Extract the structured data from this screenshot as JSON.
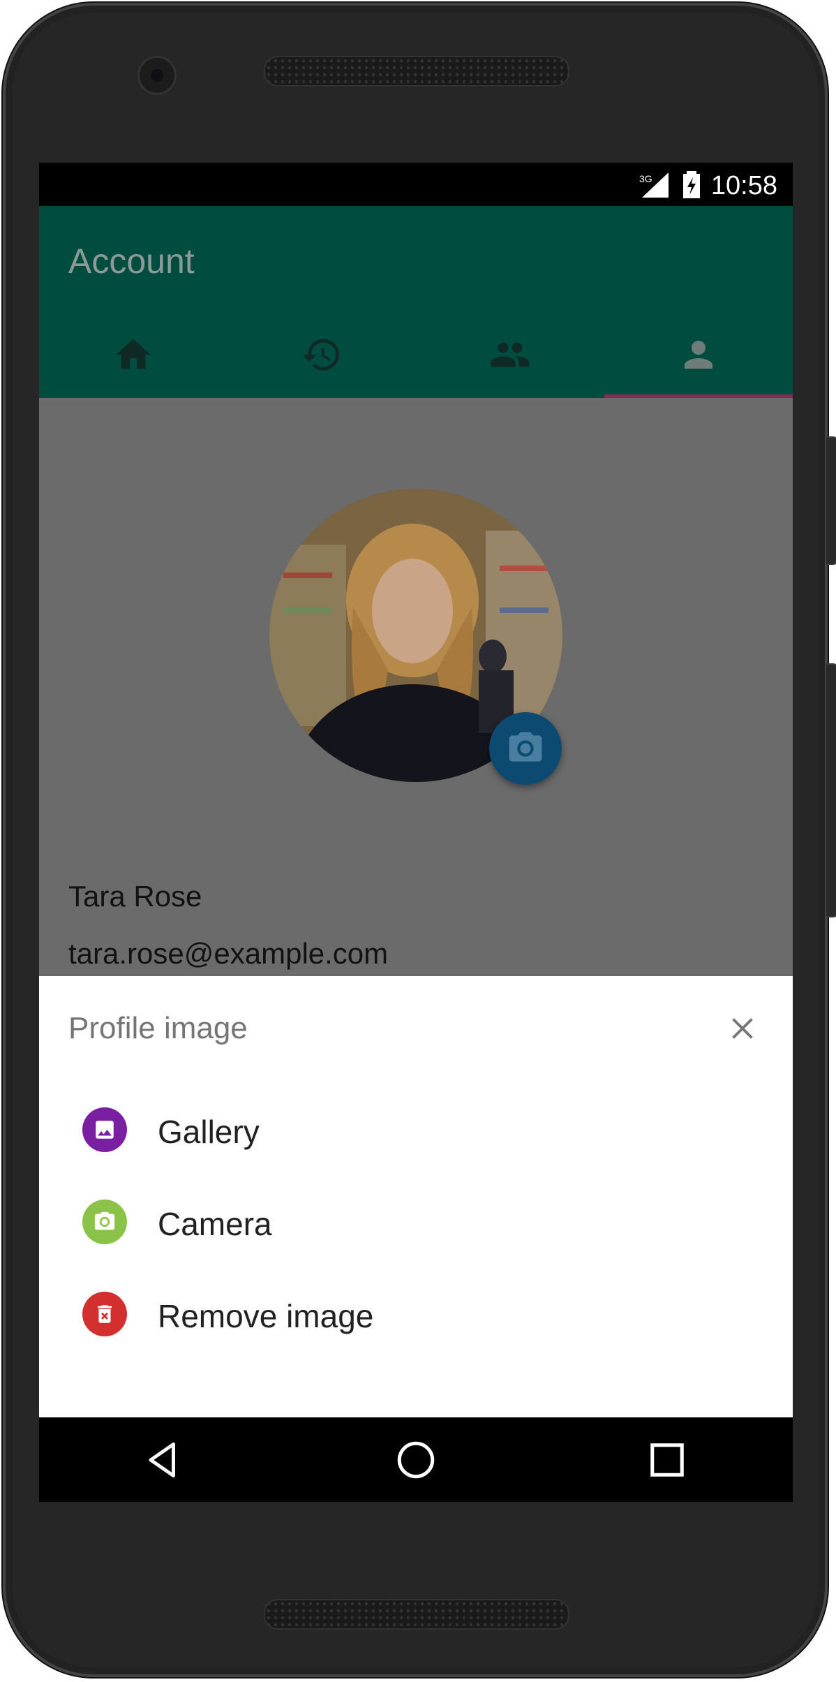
{
  "status_bar": {
    "time": "10:58",
    "network": "3G"
  },
  "app_bar": {
    "title": "Account",
    "tabs": [
      {
        "icon": "home-icon",
        "active": false
      },
      {
        "icon": "history-icon",
        "active": false
      },
      {
        "icon": "people-icon",
        "active": false
      },
      {
        "icon": "person-icon",
        "active": true
      }
    ]
  },
  "profile": {
    "name": "Tara Rose",
    "email": "tara.rose@example.com",
    "change_photo_icon": "camera-icon"
  },
  "bottom_sheet": {
    "title": "Profile image",
    "close_icon": "close-icon",
    "options": [
      {
        "label": "Gallery",
        "icon": "image-icon",
        "color": "#7b1fa2"
      },
      {
        "label": "Camera",
        "icon": "camera-icon",
        "color": "#8bc34a"
      },
      {
        "label": "Remove image",
        "icon": "delete-icon",
        "color": "#d32f2f"
      }
    ]
  },
  "nav_bar": {
    "buttons": [
      "back-icon",
      "home-circle-icon",
      "recents-icon"
    ]
  },
  "colors": {
    "app_bar": "#004d40",
    "tab_indicator": "#8a2850",
    "scrim": "#6b6b6b",
    "fab": "#0d4a72"
  }
}
